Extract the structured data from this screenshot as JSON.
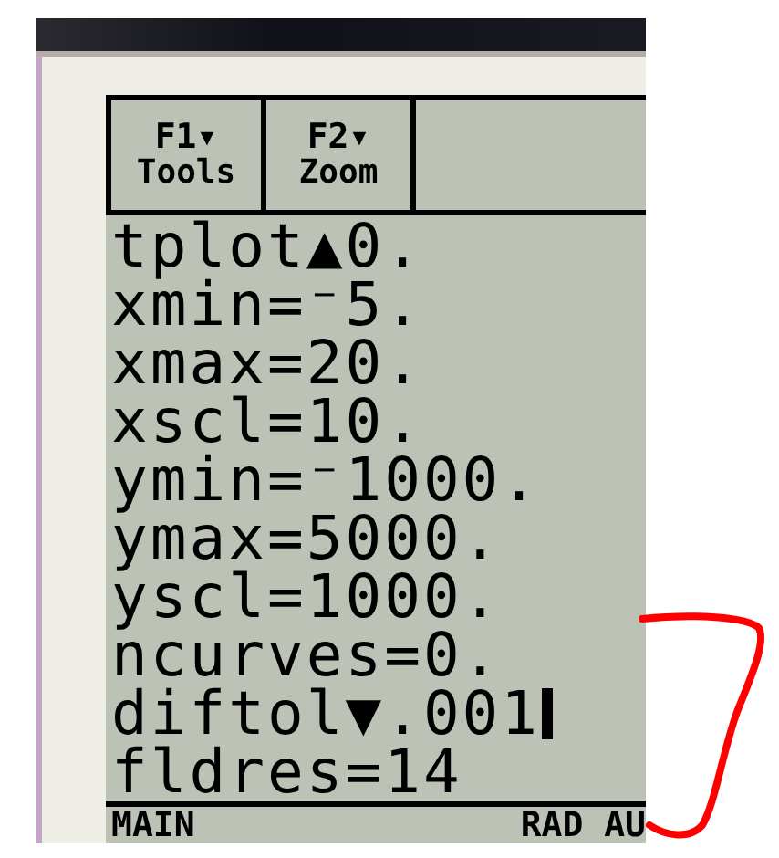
{
  "toolbar": [
    {
      "key": "F1▾",
      "label": "Tools"
    },
    {
      "key": "F2▾",
      "label": "Zoom"
    }
  ],
  "lines": [
    {
      "text": "tplot▲0.",
      "cursor": false
    },
    {
      "text": "xmin=⁻5.",
      "cursor": false
    },
    {
      "text": "xmax=20.",
      "cursor": false
    },
    {
      "text": "xscl=10.",
      "cursor": false
    },
    {
      "text": "ymin=⁻1000.",
      "cursor": false
    },
    {
      "text": "ymax=5000.",
      "cursor": false
    },
    {
      "text": "yscl=1000.",
      "cursor": false
    },
    {
      "text": "ncurves=0.",
      "cursor": false
    },
    {
      "text": "diftol▼.001",
      "cursor": true
    },
    {
      "text": "fldres=14",
      "cursor": false
    }
  ],
  "status_bar": {
    "left": "MAIN",
    "right": "RAD AU"
  }
}
